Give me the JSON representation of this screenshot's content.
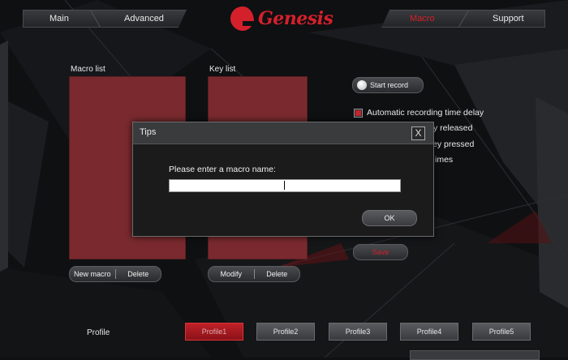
{
  "tabs": {
    "left": [
      "Main",
      "Advanced"
    ],
    "right": [
      "Macro",
      "Support"
    ],
    "active": "Macro"
  },
  "logo": {
    "text": "Genesis"
  },
  "macro_list": {
    "label": "Macro list",
    "buttons": [
      "New macro",
      "Delete"
    ]
  },
  "key_list": {
    "label": "Key list",
    "buttons": [
      "Modify",
      "Delete"
    ]
  },
  "record": {
    "start_label": "Start record",
    "options": [
      "Automatic recording time delay",
      "y released",
      "ey pressed",
      "imes"
    ],
    "checkbox_checked": true
  },
  "save_label": "Save",
  "profile": {
    "label": "Profile",
    "buttons": [
      "Profile1",
      "Profile2",
      "Profile3",
      "Profile4",
      "Profile5"
    ],
    "active": "Profile1"
  },
  "dialog": {
    "title": "Tips",
    "close_glyph": "X",
    "prompt": "Please enter a macro name:",
    "input_value": "",
    "ok_label": "OK"
  },
  "colors": {
    "accent": "#d4202b",
    "list_bg": "#7a2a2e",
    "background": "#0f1012"
  }
}
